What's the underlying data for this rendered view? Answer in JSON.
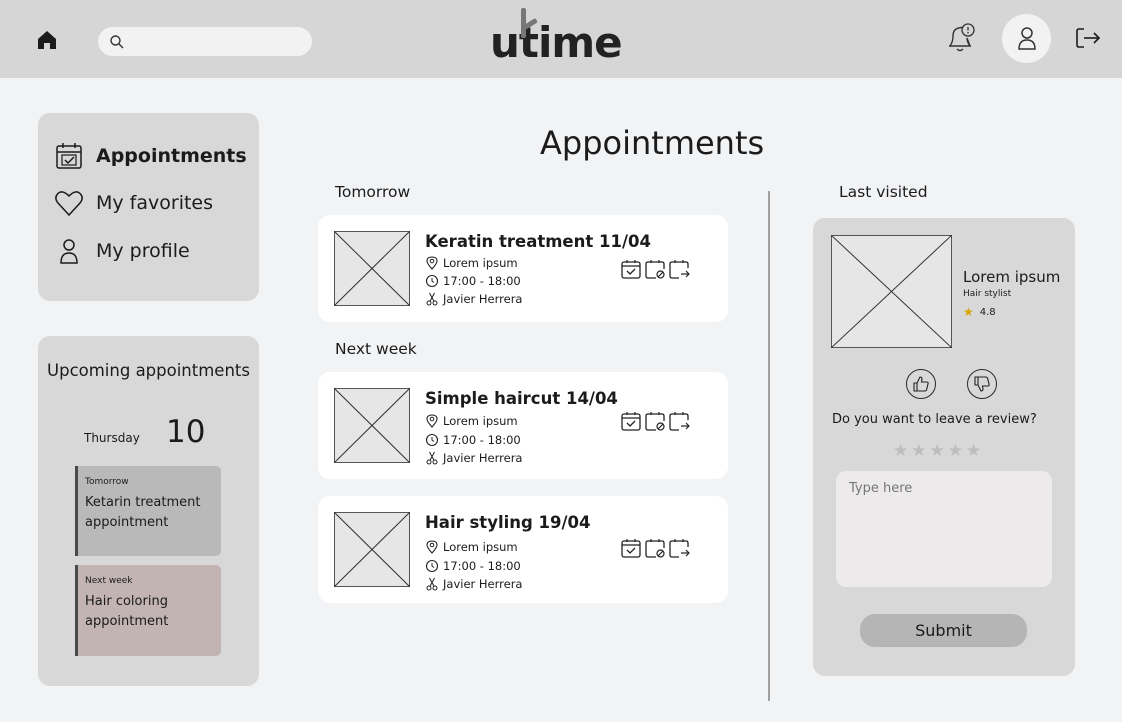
{
  "header": {
    "logo_text": "utime",
    "search": {
      "placeholder": "",
      "value": ""
    },
    "icons": [
      "home-icon",
      "search-icon",
      "bell-alert-icon",
      "user-icon",
      "logout-icon"
    ]
  },
  "sidebar": {
    "items": [
      {
        "label": "Appointments",
        "icon": "calendar-check-icon",
        "active": true
      },
      {
        "label": "My favorites",
        "icon": "heart-icon",
        "active": false
      },
      {
        "label": "My profile",
        "icon": "user-icon",
        "active": false
      }
    ]
  },
  "upcoming": {
    "title": "Upcoming appointments",
    "day_name": "Thursday",
    "day_number": "10",
    "items": [
      {
        "when": "Tomorrow",
        "what": "Ketarin treatment appointment"
      },
      {
        "when": "Next week",
        "what": "Hair coloring appointment"
      }
    ]
  },
  "main": {
    "title": "Appointments",
    "sections": [
      {
        "label": "Tomorrow",
        "appointments": [
          {
            "title": "Keratin treatment 11/04",
            "location": "Lorem ipsum",
            "time": "17:00 - 18:00",
            "stylist": "Javier Herrera"
          }
        ]
      },
      {
        "label": "Next week",
        "appointments": [
          {
            "title": "Simple haircut 14/04",
            "location": "Lorem ipsum",
            "time": "17:00 - 18:00",
            "stylist": "Javier Herrera"
          },
          {
            "title": "Hair styling 19/04",
            "location": "Lorem ipsum",
            "time": "17:00 - 18:00",
            "stylist": "Javier Herrera"
          }
        ]
      }
    ],
    "action_icons": [
      "calendar-check-icon",
      "calendar-cancel-icon",
      "calendar-reschedule-icon"
    ]
  },
  "last_visited": {
    "label": "Last visited",
    "name": "Lorem ipsum",
    "role": "Hair stylist",
    "rating": "4.8",
    "review_question": "Do you want to leave a review?",
    "review_placeholder": "Type here",
    "stars": 5,
    "submit_label": "Submit"
  },
  "colors": {
    "topbar": "#d6d6d6",
    "page_bg": "#f2f3f5",
    "card_bg": "#d8d8d8",
    "upcoming_item_1": "#b9b9b9",
    "upcoming_item_2": "#c3b4b4",
    "star_rating": "#d9a400"
  }
}
